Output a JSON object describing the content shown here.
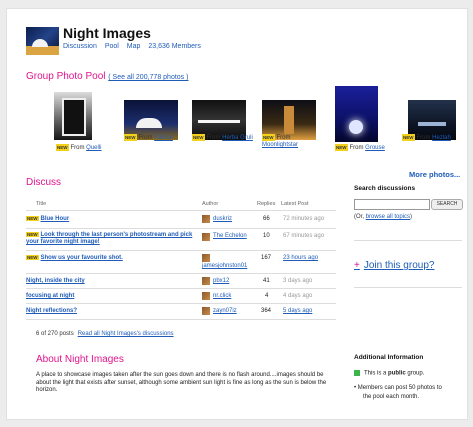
{
  "header": {
    "title": "Night Images",
    "links": [
      "Discussion",
      "Pool",
      "Map",
      "23,636 Members"
    ]
  },
  "pool": {
    "heading": "Group Photo Pool",
    "see_all": "( See all 200,778 photos )",
    "photos": [
      {
        "badge": "NEW",
        "from": "From ",
        "author": "Quelli"
      },
      {
        "badge": "NEW",
        "from": "From ",
        "author": "Patrice"
      },
      {
        "badge": "NEW",
        "from": "From ",
        "author": "Herba Gruli"
      },
      {
        "badge": "NEW",
        "from": "From ",
        "author": "Moonlightstar"
      },
      {
        "badge": "NEW",
        "from": "From ",
        "author": "Grouse"
      },
      {
        "badge": "NEW",
        "from": "From ",
        "author": "Hezlah"
      }
    ],
    "more_photos": "More photos..."
  },
  "discuss": {
    "heading": "Discuss",
    "columns": [
      "Title",
      "Author",
      "Replies",
      "Latest Post"
    ],
    "rows": [
      {
        "badge": "NEW",
        "title": "Blue Hour",
        "author": "duskriz",
        "replies": "66",
        "latest": "72 minutes ago",
        "latest_link": false
      },
      {
        "badge": "NEW",
        "title": "Look through the last person's photostream and pick your favorite night image!",
        "author": "The Echelon",
        "replies": "10",
        "latest": "67 minutes ago",
        "latest_link": false
      },
      {
        "badge": "NEW",
        "title": "Show us your favourite shot.",
        "author": "jamesjohnston01",
        "replies": "167",
        "latest": "23 hours ago",
        "latest_link": true
      },
      {
        "badge": "",
        "title": "Night, inside the city",
        "author": "pbx12",
        "replies": "41",
        "latest": "3 days ago",
        "latest_link": false
      },
      {
        "badge": "",
        "title": "focusing at night",
        "author": "nr.click",
        "replies": "4",
        "latest": "4 days ago",
        "latest_link": false
      },
      {
        "badge": "",
        "title": "Night reflections?",
        "author": "zayn07iz",
        "replies": "364",
        "latest": "5 days ago",
        "latest_link": true
      }
    ],
    "footer_count": "6 of 270 posts",
    "footer_link": "Read all Night Images's discussions"
  },
  "search": {
    "heading": "Search discussions",
    "placeholder": "",
    "button": "SEARCH",
    "browse_prefix": "(Or, ",
    "browse_link": "browse all topics",
    "browse_suffix": ")"
  },
  "join": {
    "bullet": "+",
    "label": "Join this group?"
  },
  "about": {
    "heading": "About Night Images",
    "text": "A place to showcase images taken after the sun goes down and there is no flash around....images should be about the light that exists after sunset, although some ambient sun light is fine as long as the sun is below the horizon."
  },
  "additional": {
    "heading": "Additional Information",
    "public_prefix": "This is a ",
    "public_word": "public",
    "public_suffix": " group.",
    "members_line1": "Members can post 50 photos to",
    "members_line2": "the pool each month."
  },
  "colors": {
    "accent": "#e0148d",
    "link": "#1f5cb8",
    "new_badge": "#f3d11b",
    "public_icon": "#3cb54a"
  }
}
